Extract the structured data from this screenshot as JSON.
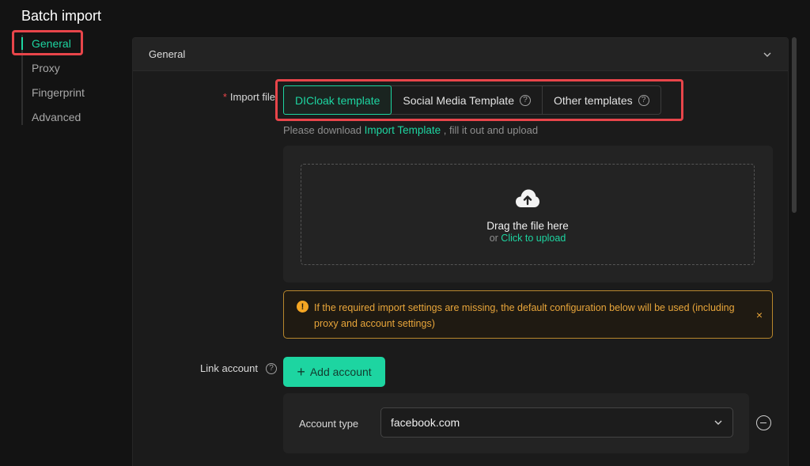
{
  "page": {
    "title": "Batch import"
  },
  "sidebar": {
    "items": [
      {
        "label": "General",
        "active": true
      },
      {
        "label": "Proxy"
      },
      {
        "label": "Fingerprint"
      },
      {
        "label": "Advanced"
      }
    ]
  },
  "panel": {
    "title": "General"
  },
  "import_file": {
    "required_mark": "*",
    "label": "Import file",
    "tabs": [
      {
        "label": "DICloak template",
        "active": true
      },
      {
        "label": "Social Media Template",
        "help_icon": "question-icon"
      },
      {
        "label": "Other templates",
        "help_icon": "question-icon"
      }
    ],
    "hint_before": "Please download ",
    "hint_link": "Import Template",
    "hint_after": " , fill it out and upload"
  },
  "upload": {
    "icon": "cloud-upload-icon",
    "title": "Drag the file here",
    "or_text": "or ",
    "link": "Click to upload"
  },
  "warning": {
    "icon": "exclamation-icon",
    "text": "If the required import settings are missing, the default configuration below will be used (including proxy and account settings)",
    "close": "×"
  },
  "link_account": {
    "label": "Link account",
    "help_icon": "question-icon",
    "add_button": "Add account",
    "add_icon": "+",
    "account_type_label": "Account type",
    "account_type_value": "facebook.com"
  },
  "colors": {
    "accent": "#1dd5a1",
    "warning": "#e9a63a",
    "highlight": "#e8454a"
  }
}
